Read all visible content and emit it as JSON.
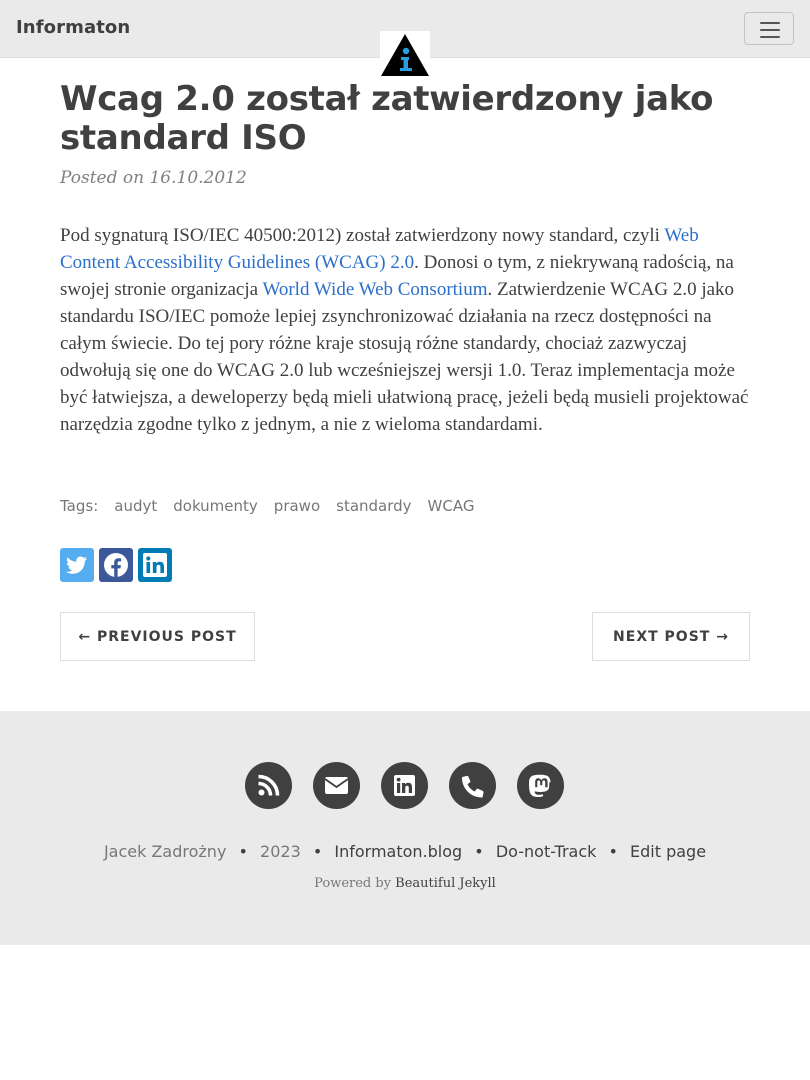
{
  "navbar": {
    "brand": "Informaton",
    "logo_icon": "info-triangle-logo",
    "menu_icon": "hamburger-menu-icon"
  },
  "post": {
    "title": "Wcag 2.0 został zatwierdzony jako standard ISO",
    "meta": "Posted on 16.10.2012",
    "body": {
      "p1_a": "Pod sygnaturą ISO/IEC 40500:2012) został zatwierdzony nowy standard, czyli ",
      "link1": "Web Content Accessibility Guidelines (WCAG) 2.0",
      "p1_b": ". Donosi o tym, z niekrywaną radością, na swojej stronie organizacja ",
      "link2": "World Wide Web Consortium",
      "p1_c": ". Zatwierdzenie WCAG 2.0 jako standardu ISO/IEC pomoże lepiej zsynchronizować działania na rzecz dostępności na całym świecie. Do tej pory różne kraje stosują różne standardy, chociaż zazwyczaj odwołują się one do WCAG 2.0 lub wcześniejszej wersji 1.0. Teraz implementacja może być łatwiejsza, a deweloperzy będą mieli ułatwioną pracę, jeżeli będą musieli projektować narzędzia zgodne tylko z jednym, a nie z wieloma standardami."
    },
    "tags_label": "Tags:",
    "tags": [
      "audyt",
      "dokumenty",
      "prawo",
      "standardy",
      "WCAG"
    ],
    "share": [
      "twitter-icon",
      "facebook-icon",
      "linkedin-icon"
    ]
  },
  "pager": {
    "prev": "← PREVIOUS POST",
    "next": "NEXT POST →"
  },
  "footer": {
    "icons": [
      "rss-icon",
      "envelope-icon",
      "linkedin-icon",
      "phone-icon",
      "mastodon-icon"
    ],
    "author": "Jacek Zadrożny",
    "year": "2023",
    "site": "Informaton.blog",
    "dnt": "Do-not-Track",
    "edit": "Edit page",
    "powered_prefix": "Powered by ",
    "powered_link": "Beautiful Jekyll",
    "separator": "•"
  },
  "colors": {
    "navbar_bg": "#eaeaea",
    "text": "#404040",
    "link": "#2a6fc9",
    "twitter": "#55acee",
    "facebook": "#3b5998",
    "linkedin": "#007bb5",
    "footer_icon_bg": "#404040"
  }
}
